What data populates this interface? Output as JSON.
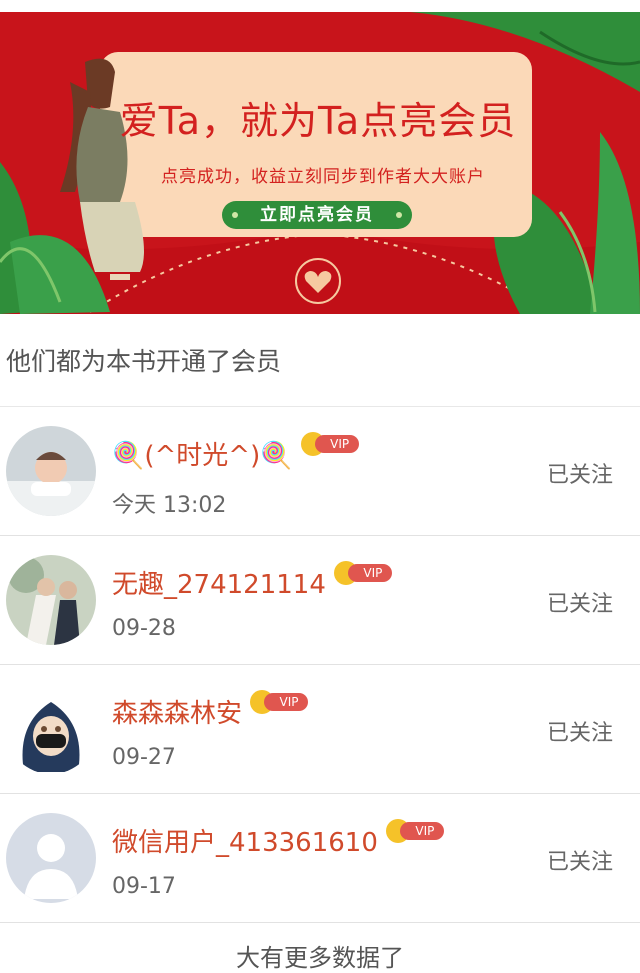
{
  "banner": {
    "title": "爱Ta，就为Ta点亮会员",
    "subtitle": "点亮成功，收益立刻同步到作者大大账户",
    "cta_label": "立即点亮会员"
  },
  "section_title": "他们都为本书开通了会员",
  "vip_badge": "VIP",
  "members": [
    {
      "name": "🍭(^时光^)🍭",
      "date": "今天 13:02",
      "follow_label": "已关注"
    },
    {
      "name": "无趣_274121114",
      "date": "09-28",
      "follow_label": "已关注"
    },
    {
      "name": "森森森林安",
      "date": "09-27",
      "follow_label": "已关注"
    },
    {
      "name": "微信用户_413361610",
      "date": "09-17",
      "follow_label": "已关注"
    }
  ],
  "footer_text": "大有更多数据了",
  "colors": {
    "banner_red": "#c8141b",
    "name_red": "#d04a2b",
    "vip_red": "#e0564f",
    "cta_green": "#2f8e3a"
  }
}
